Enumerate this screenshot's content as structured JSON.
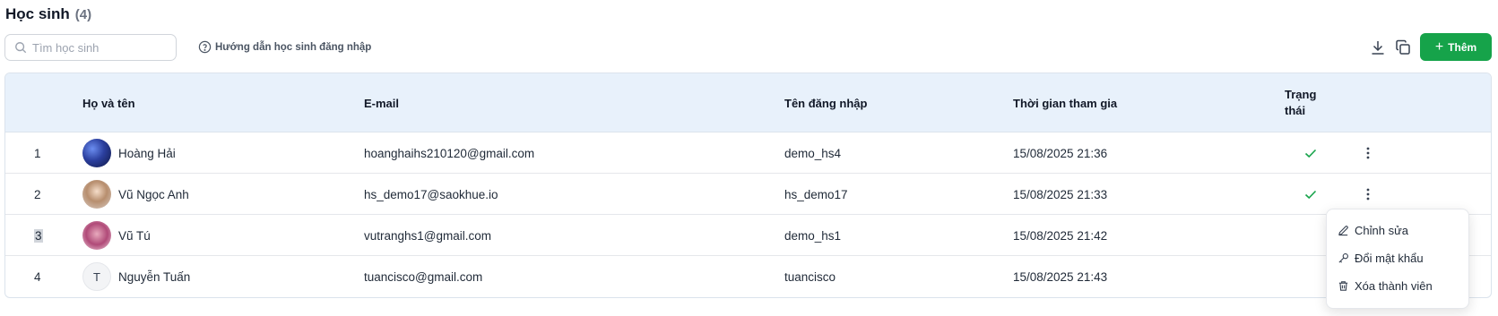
{
  "header": {
    "title": "Học sinh",
    "count": "(4)"
  },
  "search": {
    "placeholder": "Tìm học sinh",
    "value": ""
  },
  "guide_link": {
    "label": "Hướng dẫn học sinh đăng nhập"
  },
  "toolbar": {
    "add_label": "Thêm"
  },
  "table": {
    "columns": [
      "Họ và tên",
      "E-mail",
      "Tên đăng nhập",
      "Thời gian tham gia"
    ],
    "status_header": [
      "Trạng",
      "thái"
    ],
    "rows": [
      {
        "index": "1",
        "name": "Hoàng Hải",
        "email": "hoanghaihs210120@gmail.com",
        "username": "demo_hs4",
        "joined": "15/08/2025 21:36",
        "status": "active"
      },
      {
        "index": "2",
        "name": "Vũ Ngọc Anh",
        "email": "hs_demo17@saokhue.io",
        "username": "hs_demo17",
        "joined": "15/08/2025 21:33",
        "status": "active"
      },
      {
        "index": "3",
        "name": "Vũ Tú",
        "email": "vutranghs1@gmail.com",
        "username": "demo_hs1",
        "joined": "15/08/2025 21:42",
        "status": ""
      },
      {
        "index": "4",
        "name": "Nguyễn Tuấn",
        "avatar_initial": "T",
        "email": "tuancisco@gmail.com",
        "username": "tuancisco",
        "joined": "15/08/2025 21:43",
        "status": ""
      }
    ]
  },
  "row_menu": {
    "items": [
      {
        "label": "Chỉnh sửa",
        "icon": "pencil-icon"
      },
      {
        "label": "Đổi mật khẩu",
        "icon": "key-icon"
      },
      {
        "label": "Xóa thành viên",
        "icon": "trash-icon"
      }
    ]
  },
  "colors": {
    "accent": "#16a34a",
    "header_bg": "#e8f1fb",
    "check": "#16a34a"
  }
}
